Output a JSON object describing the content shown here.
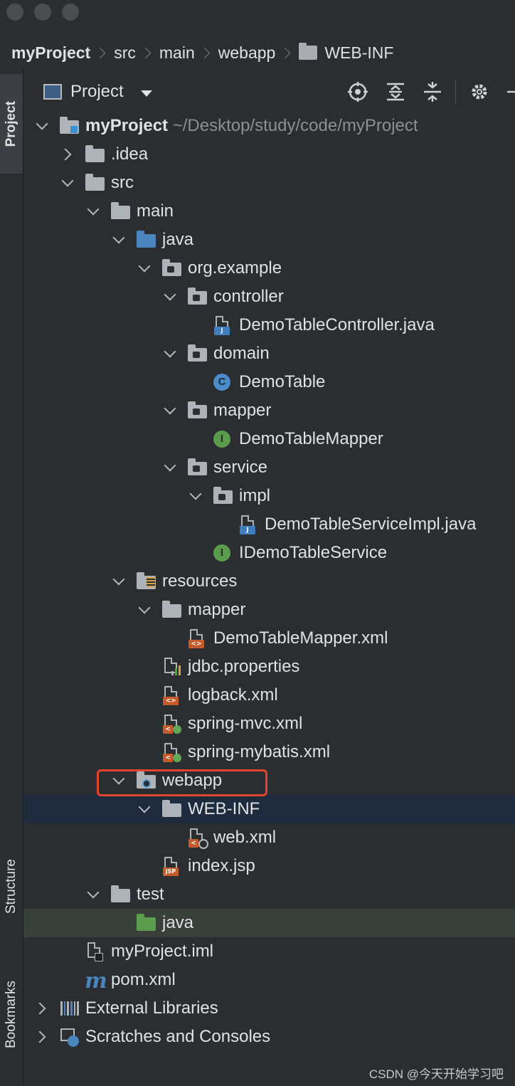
{
  "breadcrumb": [
    "myProject",
    "src",
    "main",
    "webapp",
    "WEB-INF"
  ],
  "left_strip": {
    "project_tab": "Project",
    "structure_tab": "Structure",
    "bookmarks_tab": "Bookmarks"
  },
  "panel": {
    "title": "Project",
    "toolbar_icons": [
      "locate-icon",
      "expand-all-icon",
      "collapse-all-icon",
      "gear-icon",
      "minimize-icon"
    ]
  },
  "tree": [
    {
      "label": "myProject",
      "path": " ~/Desktop/study/code/myProject",
      "depth": 0,
      "expanded": true,
      "icon": "project-folder-icon"
    },
    {
      "label": ".idea",
      "depth": 1,
      "expanded": false,
      "icon": "folder-icon"
    },
    {
      "label": "src",
      "depth": 1,
      "expanded": true,
      "icon": "folder-icon"
    },
    {
      "label": "main",
      "depth": 2,
      "expanded": true,
      "icon": "folder-icon"
    },
    {
      "label": "java",
      "depth": 3,
      "expanded": true,
      "icon": "source-folder-icon"
    },
    {
      "label": "org.example",
      "depth": 4,
      "expanded": true,
      "icon": "package-icon"
    },
    {
      "label": "controller",
      "depth": 5,
      "expanded": true,
      "icon": "package-icon"
    },
    {
      "label": "DemoTableController.java",
      "depth": 6,
      "icon": "java-file-icon"
    },
    {
      "label": "domain",
      "depth": 5,
      "expanded": true,
      "icon": "package-icon"
    },
    {
      "label": "DemoTable",
      "depth": 6,
      "icon": "class-icon"
    },
    {
      "label": "mapper",
      "depth": 5,
      "expanded": true,
      "icon": "package-icon"
    },
    {
      "label": "DemoTableMapper",
      "depth": 6,
      "icon": "interface-icon"
    },
    {
      "label": "service",
      "depth": 5,
      "expanded": true,
      "icon": "package-icon"
    },
    {
      "label": "impl",
      "depth": 6,
      "expanded": true,
      "icon": "package-icon"
    },
    {
      "label": "DemoTableServiceImpl.java",
      "depth": 7,
      "icon": "java-file-icon"
    },
    {
      "label": "IDemoTableService",
      "depth": 6,
      "icon": "interface-icon"
    },
    {
      "label": "resources",
      "depth": 3,
      "expanded": true,
      "icon": "resources-folder-icon"
    },
    {
      "label": "mapper",
      "depth": 4,
      "expanded": true,
      "icon": "folder-icon"
    },
    {
      "label": "DemoTableMapper.xml",
      "depth": 5,
      "icon": "xml-file-icon"
    },
    {
      "label": "jdbc.properties",
      "depth": 4,
      "icon": "properties-file-icon"
    },
    {
      "label": "logback.xml",
      "depth": 4,
      "icon": "xml-file-icon"
    },
    {
      "label": "spring-mvc.xml",
      "depth": 4,
      "icon": "spring-xml-icon"
    },
    {
      "label": "spring-mybatis.xml",
      "depth": 4,
      "icon": "spring-xml-icon"
    },
    {
      "label": "webapp",
      "depth": 3,
      "expanded": true,
      "icon": "web-folder-icon",
      "highlighted": true
    },
    {
      "label": "WEB-INF",
      "depth": 4,
      "expanded": true,
      "icon": "folder-icon",
      "selected": "dark"
    },
    {
      "label": "web.xml",
      "depth": 5,
      "icon": "web-xml-icon"
    },
    {
      "label": "index.jsp",
      "depth": 4,
      "icon": "jsp-file-icon"
    },
    {
      "label": "test",
      "depth": 2,
      "expanded": true,
      "icon": "folder-icon"
    },
    {
      "label": "java",
      "depth": 3,
      "icon": "test-source-folder-icon",
      "selected": "green"
    },
    {
      "label": "myProject.iml",
      "depth": 1,
      "icon": "iml-file-icon"
    },
    {
      "label": "pom.xml",
      "depth": 1,
      "icon": "maven-icon"
    },
    {
      "label": "External Libraries",
      "depth": 0,
      "expanded": false,
      "icon": "libraries-icon"
    },
    {
      "label": "Scratches and Consoles",
      "depth": 0,
      "expanded": false,
      "icon": "scratches-icon"
    }
  ],
  "watermark": "CSDN @今天开始学习吧",
  "colors": {
    "background": "#2b2d30",
    "selection": "#1d2b3d",
    "highlight_box": "#e0452d",
    "test_selection": "#393f39"
  }
}
